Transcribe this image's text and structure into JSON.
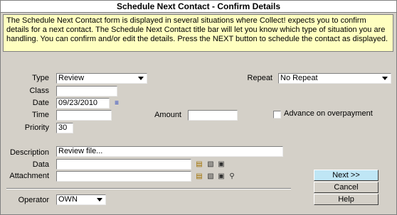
{
  "window": {
    "title": "Schedule Next Contact - Confirm Details"
  },
  "info": {
    "text": "The Schedule Next Contact form is displayed in several situations where Collect! expects you to confirm details for a next contact. The Schedule Next Contact title bar will let you know which type of situation you are handling. You can confirm and/or edit the details. Press the NEXT button to schedule the contact as displayed."
  },
  "form": {
    "type_label": "Type",
    "type_value": "Review",
    "class_label": "Class",
    "class_value": "",
    "date_label": "Date",
    "date_value": "09/23/2010",
    "time_label": "Time",
    "time_value": "",
    "priority_label": "Priority",
    "priority_value": "30",
    "repeat_label": "Repeat",
    "repeat_value": "No Repeat",
    "amount_label": "Amount",
    "amount_value": "",
    "advance_label": "Advance on overpayment",
    "description_label": "Description",
    "description_value": "Review file...",
    "data_label": "Data",
    "data_value": "",
    "attachment_label": "Attachment",
    "attachment_value": "",
    "operator_label": "Operator",
    "operator_value": "OWN"
  },
  "buttons": {
    "next": "Next >>",
    "cancel": "Cancel",
    "help": "Help"
  },
  "icons": {
    "calendar": "calendar-icon",
    "folder": "folder-open-icon",
    "disk": "disk-icon",
    "delete": "delete-icon",
    "search": "magnifier-icon"
  },
  "colors": {
    "info_bg": "#ffffc0",
    "next_bg": "#bfe6f5",
    "window_bg": "#d4d0c8"
  }
}
